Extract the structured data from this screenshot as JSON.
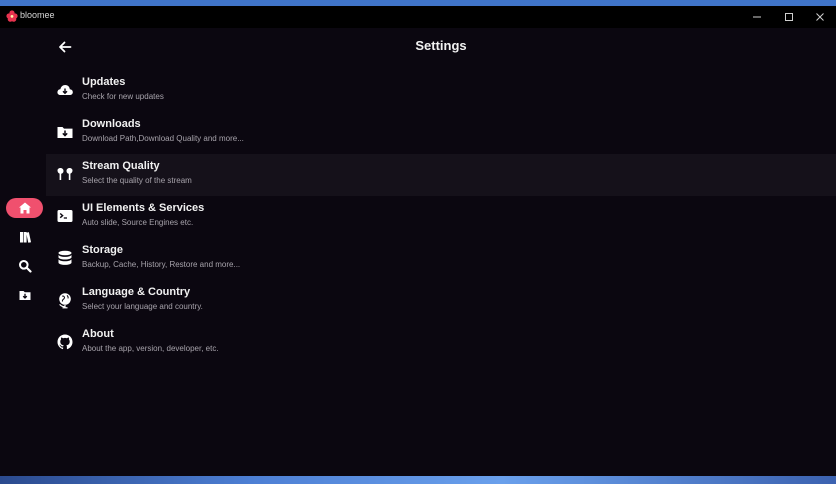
{
  "window": {
    "app_name": "bloomee",
    "minimize": "—",
    "maximize": "☐",
    "close": "✕"
  },
  "rail": {
    "items": [
      {
        "name": "home",
        "active": true
      },
      {
        "name": "library",
        "active": false
      },
      {
        "name": "search",
        "active": false
      },
      {
        "name": "downloads",
        "active": false
      }
    ]
  },
  "header": {
    "title": "Settings"
  },
  "settings": [
    {
      "title": "Updates",
      "subtitle": "Check for new updates",
      "icon": "cloud-download-icon"
    },
    {
      "title": "Downloads",
      "subtitle": "Download Path,Download Quality and more...",
      "icon": "folder-download-icon"
    },
    {
      "title": "Stream Quality",
      "subtitle": "Select the quality of the stream",
      "icon": "earbuds-icon"
    },
    {
      "title": "UI Elements & Services",
      "subtitle": "Auto slide, Source Engines etc.",
      "icon": "terminal-window-icon"
    },
    {
      "title": "Storage",
      "subtitle": "Backup, Cache, History, Restore and more...",
      "icon": "database-icon"
    },
    {
      "title": "Language & Country",
      "subtitle": "Select your language and country.",
      "icon": "globe-icon"
    },
    {
      "title": "About",
      "subtitle": "About the app, version, developer, etc.",
      "icon": "github-icon"
    }
  ],
  "colors": {
    "accent": "#f0506e",
    "background": "#0b0710",
    "highlight_row": "#15111a",
    "text": "#f1f1f1",
    "subtext": "#a7a3ab"
  }
}
